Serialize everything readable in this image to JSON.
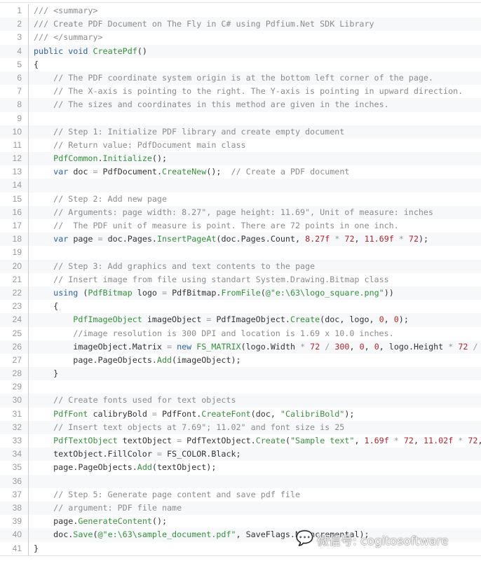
{
  "colors": {
    "comment": "#8c8c8c",
    "keyword": "#2c63a8",
    "method": "#34923a",
    "string": "#34923a",
    "number": "#b5232e",
    "row_alt": "#f6f8fa"
  },
  "lines": [
    [
      [
        "c",
        "/// <summary>"
      ]
    ],
    [
      [
        "c",
        "/// Create PDF Document on The Fly in C# using Pdfium.Net SDK Library"
      ]
    ],
    [
      [
        "c",
        "/// </summary>"
      ]
    ],
    [
      [
        "k",
        "public void "
      ],
      [
        "m",
        "CreatePdf"
      ],
      [
        "p",
        "()"
      ]
    ],
    [
      [
        "p",
        "{"
      ]
    ],
    [
      [
        "p",
        "    "
      ],
      [
        "c",
        "// The PDF coordinate system origin is at the bottom left corner of the page."
      ]
    ],
    [
      [
        "p",
        "    "
      ],
      [
        "c",
        "// The X-axis is pointing to the right. The Y-axis is pointing in upward direction."
      ]
    ],
    [
      [
        "p",
        "    "
      ],
      [
        "c",
        "// The sizes and coordinates in this method are given in the inches."
      ]
    ],
    [],
    [
      [
        "p",
        "    "
      ],
      [
        "c",
        "// Step 1: Initialize PDF library and create empty document"
      ]
    ],
    [
      [
        "p",
        "    "
      ],
      [
        "c",
        "// Return value: PdfDocument main class"
      ]
    ],
    [
      [
        "p",
        "    "
      ],
      [
        "m",
        "PdfCommon"
      ],
      [
        "p",
        "."
      ],
      [
        "m",
        "Initialize"
      ],
      [
        "p",
        "();"
      ]
    ],
    [
      [
        "p",
        "    "
      ],
      [
        "k",
        "var"
      ],
      [
        "p",
        " doc "
      ],
      [
        "o",
        "="
      ],
      [
        "p",
        " PdfDocument."
      ],
      [
        "m",
        "CreateNew"
      ],
      [
        "p",
        "();  "
      ],
      [
        "c",
        "// Create a PDF document"
      ]
    ],
    [],
    [
      [
        "p",
        "    "
      ],
      [
        "c",
        "// Step 2: Add new page"
      ]
    ],
    [
      [
        "p",
        "    "
      ],
      [
        "c",
        "// Arguments: page width: 8.27\", page height: 11.69\", Unit of measure: inches"
      ]
    ],
    [
      [
        "p",
        "    "
      ],
      [
        "c",
        "//  The PDF unit of measure is point. There are 72 points in one inch."
      ]
    ],
    [
      [
        "p",
        "    "
      ],
      [
        "k",
        "var"
      ],
      [
        "p",
        " page "
      ],
      [
        "o",
        "="
      ],
      [
        "p",
        " doc.Pages."
      ],
      [
        "m",
        "InsertPageAt"
      ],
      [
        "p",
        "(doc.Pages.Count, "
      ],
      [
        "n",
        "8.27f"
      ],
      [
        "o",
        " * "
      ],
      [
        "n",
        "72"
      ],
      [
        "p",
        ", "
      ],
      [
        "n",
        "11.69f"
      ],
      [
        "o",
        " * "
      ],
      [
        "n",
        "72"
      ],
      [
        "p",
        ");"
      ]
    ],
    [],
    [
      [
        "p",
        "    "
      ],
      [
        "c",
        "// Step 3: Add graphics and text contents to the page"
      ]
    ],
    [
      [
        "p",
        "    "
      ],
      [
        "c",
        "// Insert image from file using standart System.Drawing.Bitmap class"
      ]
    ],
    [
      [
        "p",
        "    "
      ],
      [
        "k",
        "using"
      ],
      [
        "p",
        " ("
      ],
      [
        "m",
        "PdfBitmap"
      ],
      [
        "p",
        " logo "
      ],
      [
        "o",
        "="
      ],
      [
        "p",
        " PdfBitmap."
      ],
      [
        "m",
        "FromFile"
      ],
      [
        "p",
        "("
      ],
      [
        "s",
        "@\"e:\\63\\logo_square.png\""
      ],
      [
        "p",
        "))"
      ]
    ],
    [
      [
        "p",
        "    {"
      ]
    ],
    [
      [
        "p",
        "        "
      ],
      [
        "m",
        "PdfImageObject"
      ],
      [
        "p",
        " imageObject "
      ],
      [
        "o",
        "="
      ],
      [
        "p",
        " PdfImageObject."
      ],
      [
        "m",
        "Create"
      ],
      [
        "p",
        "(doc, logo, "
      ],
      [
        "n",
        "0"
      ],
      [
        "p",
        ", "
      ],
      [
        "n",
        "0"
      ],
      [
        "p",
        ");"
      ]
    ],
    [
      [
        "p",
        "        "
      ],
      [
        "c",
        "//image resolution is 300 DPI and location is 1.69 x 10.0 inches."
      ]
    ],
    [
      [
        "p",
        "        imageObject.Matrix "
      ],
      [
        "o",
        "="
      ],
      [
        "p",
        " "
      ],
      [
        "k",
        "new"
      ],
      [
        "p",
        " "
      ],
      [
        "m",
        "FS_MATRIX"
      ],
      [
        "p",
        "(logo.Width "
      ],
      [
        "o",
        "*"
      ],
      [
        "p",
        " "
      ],
      [
        "n",
        "72"
      ],
      [
        "o",
        " / "
      ],
      [
        "n",
        "300"
      ],
      [
        "p",
        ", "
      ],
      [
        "n",
        "0"
      ],
      [
        "p",
        ", "
      ],
      [
        "n",
        "0"
      ],
      [
        "p",
        ", logo.Height "
      ],
      [
        "o",
        "*"
      ],
      [
        "p",
        " "
      ],
      [
        "n",
        "72"
      ],
      [
        "o",
        " / "
      ]
    ],
    [
      [
        "p",
        "        page.PageObjects."
      ],
      [
        "m",
        "Add"
      ],
      [
        "p",
        "(imageObject);"
      ]
    ],
    [
      [
        "p",
        "    }"
      ]
    ],
    [],
    [
      [
        "p",
        "    "
      ],
      [
        "c",
        "// Create fonts used for text objects"
      ]
    ],
    [
      [
        "p",
        "    "
      ],
      [
        "m",
        "PdfFont"
      ],
      [
        "p",
        " calibryBold "
      ],
      [
        "o",
        "="
      ],
      [
        "p",
        " PdfFont."
      ],
      [
        "m",
        "CreateFont"
      ],
      [
        "p",
        "(doc, "
      ],
      [
        "s",
        "\"CalibriBold\""
      ],
      [
        "p",
        ");"
      ]
    ],
    [
      [
        "p",
        "    "
      ],
      [
        "c",
        "// Insert text objects at 7.69\"; 11.02\" and font size is 25"
      ]
    ],
    [
      [
        "p",
        "    "
      ],
      [
        "m",
        "PdfTextObject"
      ],
      [
        "p",
        " textObject "
      ],
      [
        "o",
        "="
      ],
      [
        "p",
        " PdfTextObject."
      ],
      [
        "m",
        "Create"
      ],
      [
        "p",
        "("
      ],
      [
        "s",
        "\"Sample text\""
      ],
      [
        "p",
        ", "
      ],
      [
        "n",
        "1.69f"
      ],
      [
        "o",
        " * "
      ],
      [
        "n",
        "72"
      ],
      [
        "p",
        ", "
      ],
      [
        "n",
        "11.02f"
      ],
      [
        "o",
        " * "
      ],
      [
        "n",
        "72"
      ],
      [
        "p",
        ","
      ]
    ],
    [
      [
        "p",
        "    textObject.FillColor "
      ],
      [
        "o",
        "="
      ],
      [
        "p",
        " FS_COLOR.Black;"
      ]
    ],
    [
      [
        "p",
        "    page.PageObjects."
      ],
      [
        "m",
        "Add"
      ],
      [
        "p",
        "(textObject);"
      ]
    ],
    [],
    [
      [
        "p",
        "    "
      ],
      [
        "c",
        "// Step 5: Generate page content and save pdf file"
      ]
    ],
    [
      [
        "p",
        "    "
      ],
      [
        "c",
        "// argument: PDF file name"
      ]
    ],
    [
      [
        "p",
        "    page."
      ],
      [
        "m",
        "GenerateContent"
      ],
      [
        "p",
        "();"
      ]
    ],
    [
      [
        "p",
        "    doc."
      ],
      [
        "m",
        "Save"
      ],
      [
        "p",
        "("
      ],
      [
        "s",
        "@\"e:\\63\\sample_document.pdf\""
      ],
      [
        "p",
        ", SaveFlags.NoIncremental);"
      ]
    ],
    [
      [
        "p",
        "}"
      ]
    ]
  ],
  "watermark": {
    "icon": "wechat-icon",
    "text": "微信号: cogitosoftware"
  }
}
